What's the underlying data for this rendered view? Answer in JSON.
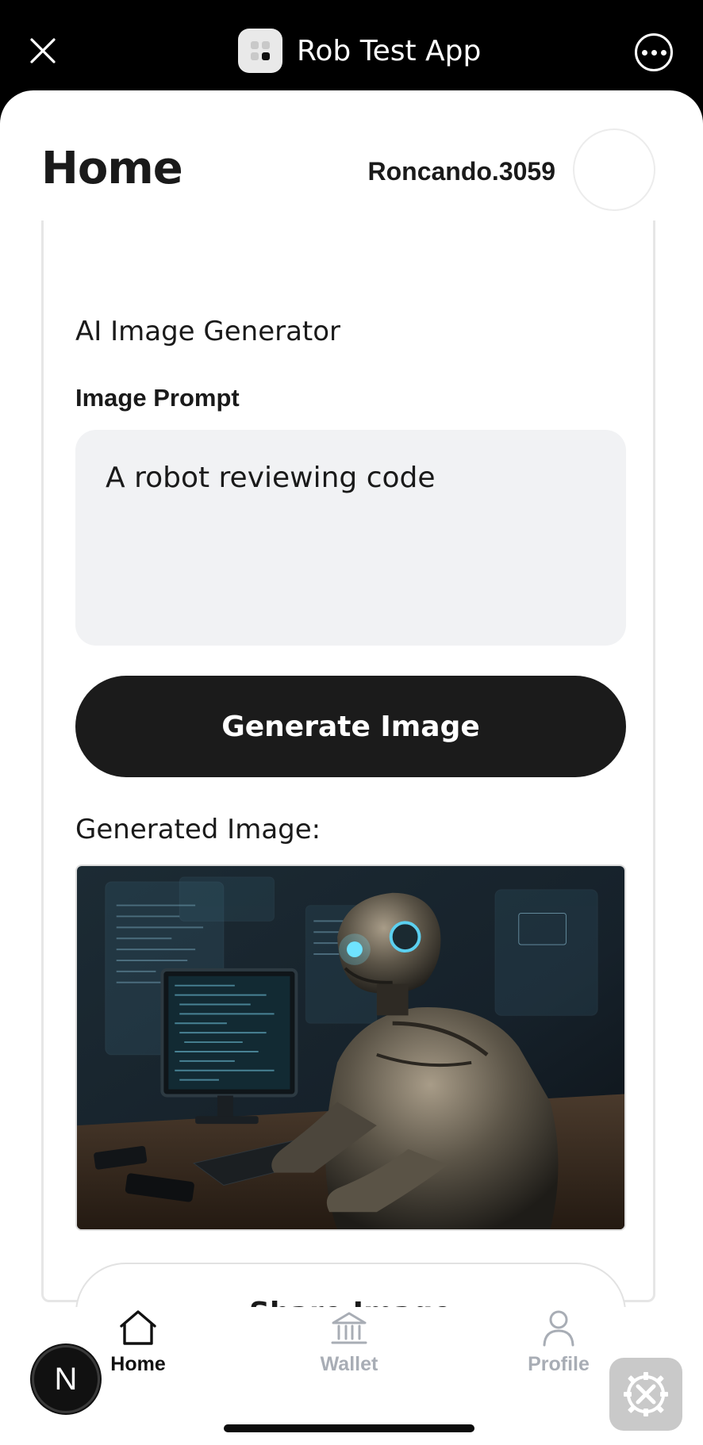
{
  "topbar": {
    "title": "Rob Test App",
    "close_icon": "close-icon",
    "more_icon": "more-horizontal-icon"
  },
  "header": {
    "title": "Home",
    "username": "Roncando.3059"
  },
  "generator": {
    "section_title": "AI Image Generator",
    "prompt_label": "Image Prompt",
    "prompt_value": "A robot reviewing code",
    "generate_label": "Generate Image",
    "generated_label": "Generated Image:",
    "share_label": "Share Image"
  },
  "nav": {
    "items": [
      {
        "label": "Home",
        "icon": "home-icon",
        "active": true
      },
      {
        "label": "Wallet",
        "icon": "bank-icon",
        "active": false
      },
      {
        "label": "Profile",
        "icon": "user-icon",
        "active": false
      }
    ]
  },
  "badge": {
    "letter": "N"
  },
  "colors": {
    "primary_button": "#1b1b1b",
    "input_bg": "#f1f2f4",
    "inactive_nav": "#a8adb5"
  }
}
